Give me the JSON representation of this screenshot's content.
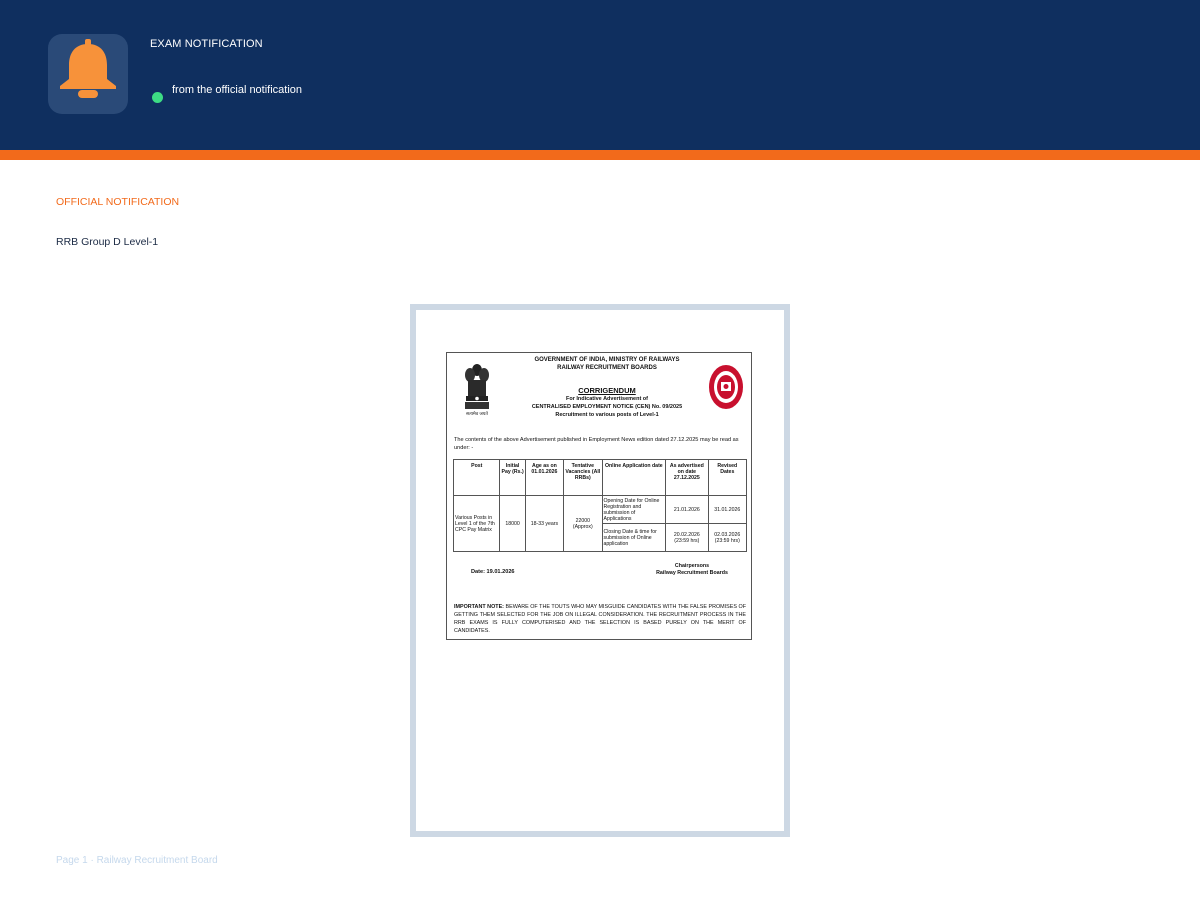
{
  "header": {
    "title": "EXAM NOTIFICATION",
    "subtitle": "from the official notification",
    "icon": "bell-icon",
    "colors": {
      "background": "#0f2f5f",
      "accent": "#f26a1b",
      "icon": "#f7923a",
      "status": "#3ddc84"
    }
  },
  "main": {
    "section_label": "OFFICIAL NOTIFICATION",
    "document_name": "RRB Group D Level-1"
  },
  "document": {
    "header_line1": "GOVERNMENT OF INDIA, MINISTRY OF RAILWAYS",
    "header_line2": "RAILWAY RECRUITMENT BOARDS",
    "emblem_caption": "सत्यमेव जयते",
    "title": "CORRIGENDUM",
    "sub_line1": "For Indicative Advertisement of",
    "sub_line2": "CENTRALISED EMPLOYMENT NOTICE (CEN) No. 09/2025",
    "sub_line3": "Recruitment to various posts of Level-1",
    "paragraph": "The contents of the above Advertisement published in Employment News edition dated 27.12.2025 may be read as under: -",
    "table": {
      "headers": [
        "Post",
        "Initial Pay (Rs.)",
        "Age as on 01.01.2026",
        "Tentative Vacancies (All RRBs)",
        "Online Application date",
        "As advertised on date 27.12.2025",
        "Revised Dates"
      ],
      "post": "Various Posts in Level 1 of the 7th CPC Pay Matrix",
      "pay": "18000",
      "age": "18-33 years",
      "vacancies": "22000 (Approx)",
      "row1_label": "Opening Date for Online Registration and submission of Applications",
      "row1_advertised": "21.01.2026",
      "row1_revised": "31.01.2026",
      "row2_label": "Closing Date & time for submission of Online application",
      "row2_advertised": "20.02.2026 (23:59 hrs)",
      "row2_revised": "02.03.2026 (23:59 hrs)"
    },
    "date": "Date: 19.01.2026",
    "sign_line1": "Chairpersons",
    "sign_line2": "Railway Recruitment Boards",
    "note_label": "IMPORTANT NOTE:",
    "note_text": "BEWARE OF THE TOUTS WHO MAY MISGUIDE CANDIDATES WITH THE FALSE PROMISES OF GETTING THEM SELECTED FOR THE JOB ON ILLEGAL CONSIDERATION. THE RECRUITMENT PROCESS IN THE RRB EXAMS IS FULLY COMPUTERISED AND THE SELECTION IS BASED PURELY ON THE MERIT OF CANDIDATES."
  },
  "footer": {
    "text": "Page 1 · Railway Recruitment Board"
  }
}
